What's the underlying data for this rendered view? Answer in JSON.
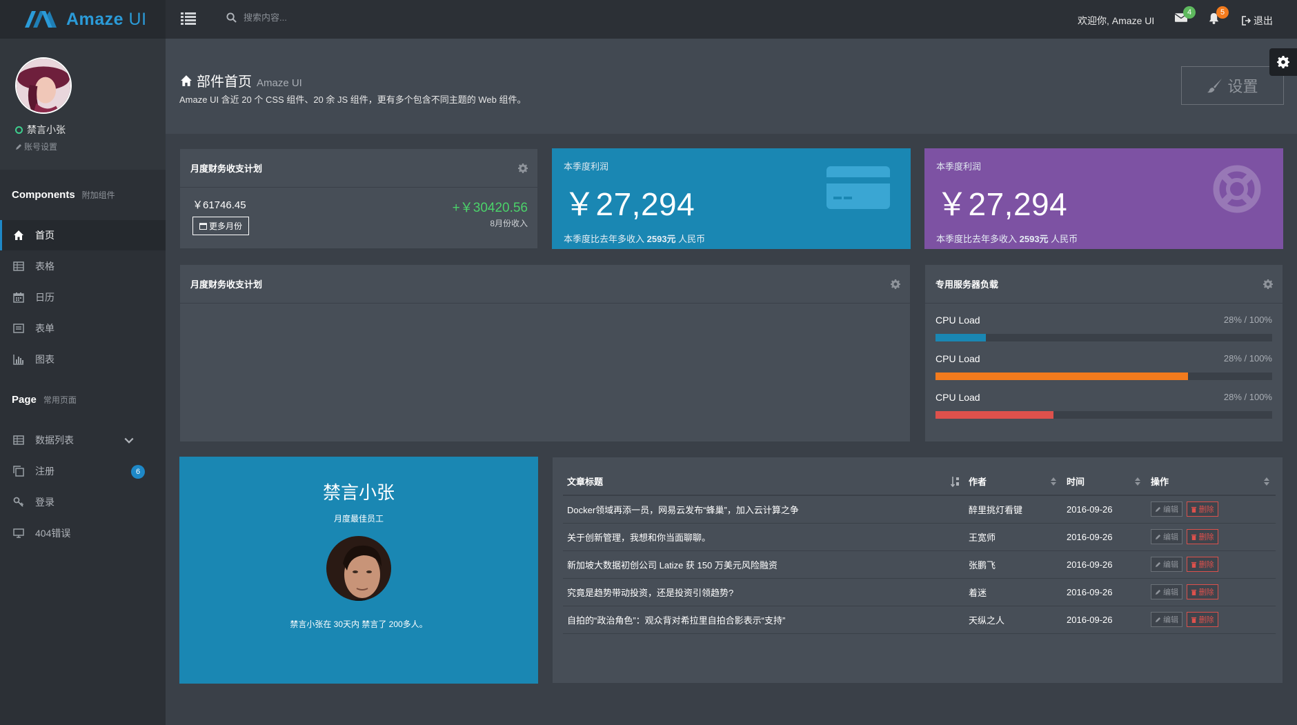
{
  "brand": {
    "name_bold": "Amaze",
    "name_light": " UI",
    "logo_color": "#2b9bd8"
  },
  "topbar": {
    "search_placeholder": "搜索内容...",
    "welcome": "欢迎你, Amaze UI",
    "mail_badge": "4",
    "bell_badge": "5",
    "logout": "退出",
    "mail_badge_color": "#5eb95e",
    "bell_badge_color": "#f37b1d"
  },
  "sidebar": {
    "username": "禁言小张",
    "account_settings": "账号设置",
    "components_title": "Components",
    "components_sub": "附加组件",
    "components_items": [
      {
        "label": "首页",
        "icon": "home-icon"
      },
      {
        "label": "表格",
        "icon": "table-icon"
      },
      {
        "label": "日历",
        "icon": "calendar-icon"
      },
      {
        "label": "表单",
        "icon": "form-icon"
      },
      {
        "label": "图表",
        "icon": "chart-icon"
      }
    ],
    "page_title": "Page",
    "page_sub": "常用页面",
    "page_items": [
      {
        "label": "数据列表",
        "icon": "table-icon"
      },
      {
        "label": "注册",
        "icon": "copy-icon",
        "badge": "6"
      },
      {
        "label": "登录",
        "icon": "key-icon"
      },
      {
        "label": "404错误",
        "icon": "monitor-icon"
      }
    ]
  },
  "header": {
    "title": "部件首页",
    "subtitle": "Amaze UI",
    "description": "Amaze UI 含近 20 个 CSS 组件、20 余 JS 组件，更有多个包含不同主题的 Web 组件。",
    "settings_button": "设置"
  },
  "finance": {
    "title": "月度财务收支计划",
    "amount": "￥61746.45",
    "more_button": "更多月份",
    "income": "+￥30420.56",
    "income_label": "8月份收入"
  },
  "stat_blue": {
    "label": "本季度利润",
    "value": "￥27,294",
    "note_prefix": "本季度比去年多收入 ",
    "note_bold": "2593元",
    "note_suffix": " 人民币",
    "color": "#1a87b3"
  },
  "stat_purple": {
    "label": "本季度利润",
    "value": "￥27,294",
    "note_prefix": "本季度比去年多收入 ",
    "note_bold": "2593元",
    "note_suffix": " 人民币",
    "color": "#7d52a3"
  },
  "chart_card": {
    "title": "月度财务收支计划"
  },
  "server": {
    "title": "专用服务器负载",
    "rows": [
      {
        "label": "CPU Load",
        "value": "28% / 100%",
        "fill": 0.15,
        "color": "#1a87b3"
      },
      {
        "label": "CPU Load",
        "value": "28% / 100%",
        "fill": 0.75,
        "color": "#f37b1d"
      },
      {
        "label": "CPU Load",
        "value": "28% / 100%",
        "fill": 0.35,
        "color": "#dd514c"
      }
    ]
  },
  "employee": {
    "name": "禁言小张",
    "role": "月度最佳员工",
    "note": "禁言小张在 30天内 禁言了 200多人。"
  },
  "articles": {
    "headers": [
      "文章标题",
      "作者",
      "时间",
      "操作"
    ],
    "edit_label": "编辑",
    "delete_label": "删除",
    "rows": [
      {
        "title": "Docker领域再添一员，网易云发布“蜂巢”，加入云计算之争",
        "author": "醉里挑灯看键",
        "date": "2016-09-26"
      },
      {
        "title": "关于创新管理，我想和你当面聊聊。",
        "author": "王宽师",
        "date": "2016-09-26"
      },
      {
        "title": "新加坡大数据初创公司 Latize 获 150 万美元风险融资",
        "author": "张鹏飞",
        "date": "2016-09-26"
      },
      {
        "title": "究竟是趋势带动投资，还是投资引领趋势?",
        "author": "着迷",
        "date": "2016-09-26"
      },
      {
        "title": "自拍的“政治角色”：观众背对希拉里自拍合影表示“支持”",
        "author": "天纵之人",
        "date": "2016-09-26"
      }
    ]
  }
}
